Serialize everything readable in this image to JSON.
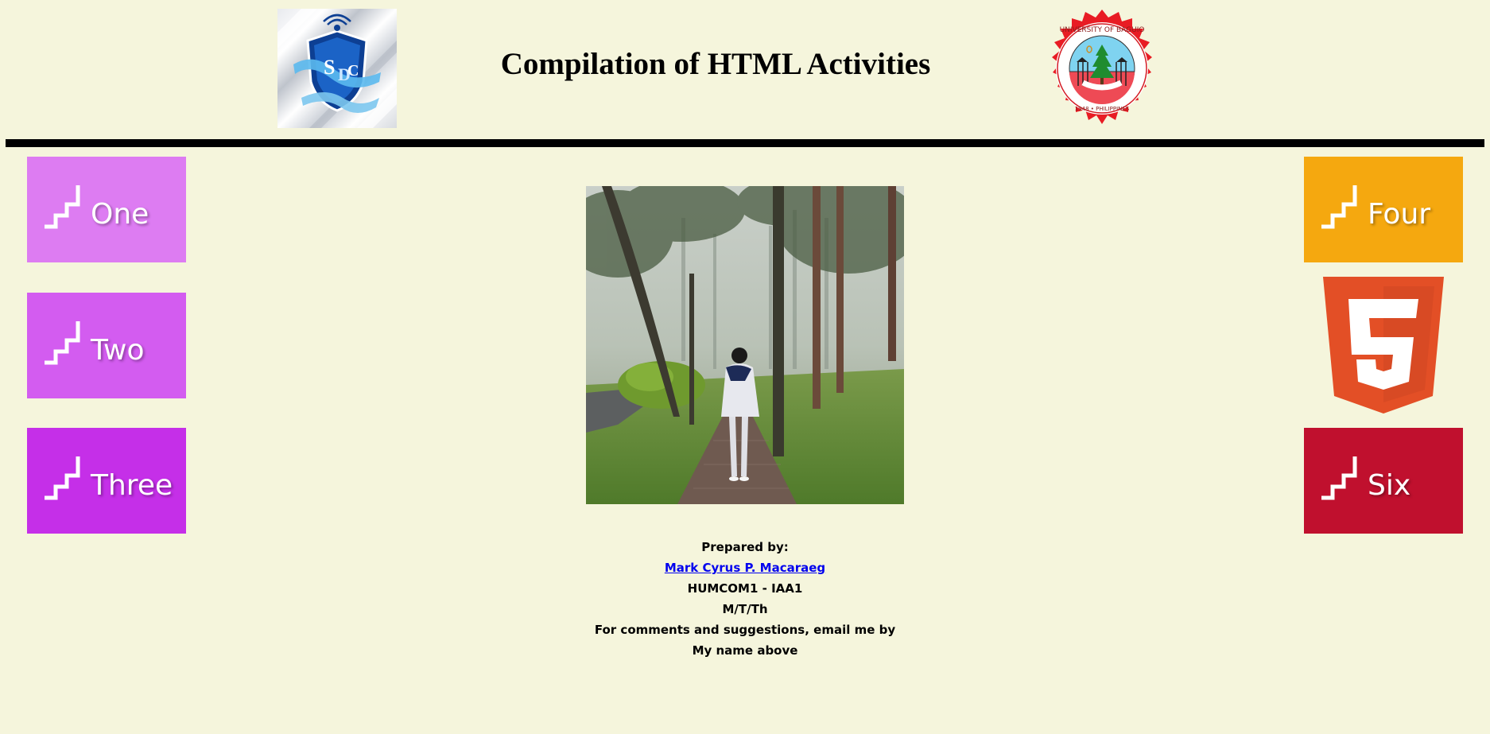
{
  "header": {
    "title": "Compilation of HTML Activities",
    "left_logo_icon": "sdc-shield-logo",
    "right_logo_icon": "university-of-baguio-seal"
  },
  "nav": {
    "left": [
      {
        "label": "One",
        "color": "#dd7cf2",
        "icon": "stairs-icon"
      },
      {
        "label": "Two",
        "color": "#d35cf0",
        "icon": "stairs-icon"
      },
      {
        "label": "Three",
        "color": "#c52fe8",
        "icon": "stairs-icon"
      }
    ],
    "right": [
      {
        "label": "Four",
        "color": "#f5a80f",
        "icon": "stairs-icon"
      },
      {
        "label": "Six",
        "color": "#c0102e",
        "icon": "stairs-icon"
      }
    ],
    "html5_icon": "html5-icon"
  },
  "photo": {
    "icon": "forest-path-photo"
  },
  "footer": {
    "prepared_by": "Prepared by:",
    "author_link": "Mark Cyrus P. Macaraeg",
    "course": "HUMCOM1 - IAA1",
    "schedule": "M/T/Th",
    "comment_line": "For comments and suggestions, email me by",
    "comment_line2": "My name above"
  }
}
